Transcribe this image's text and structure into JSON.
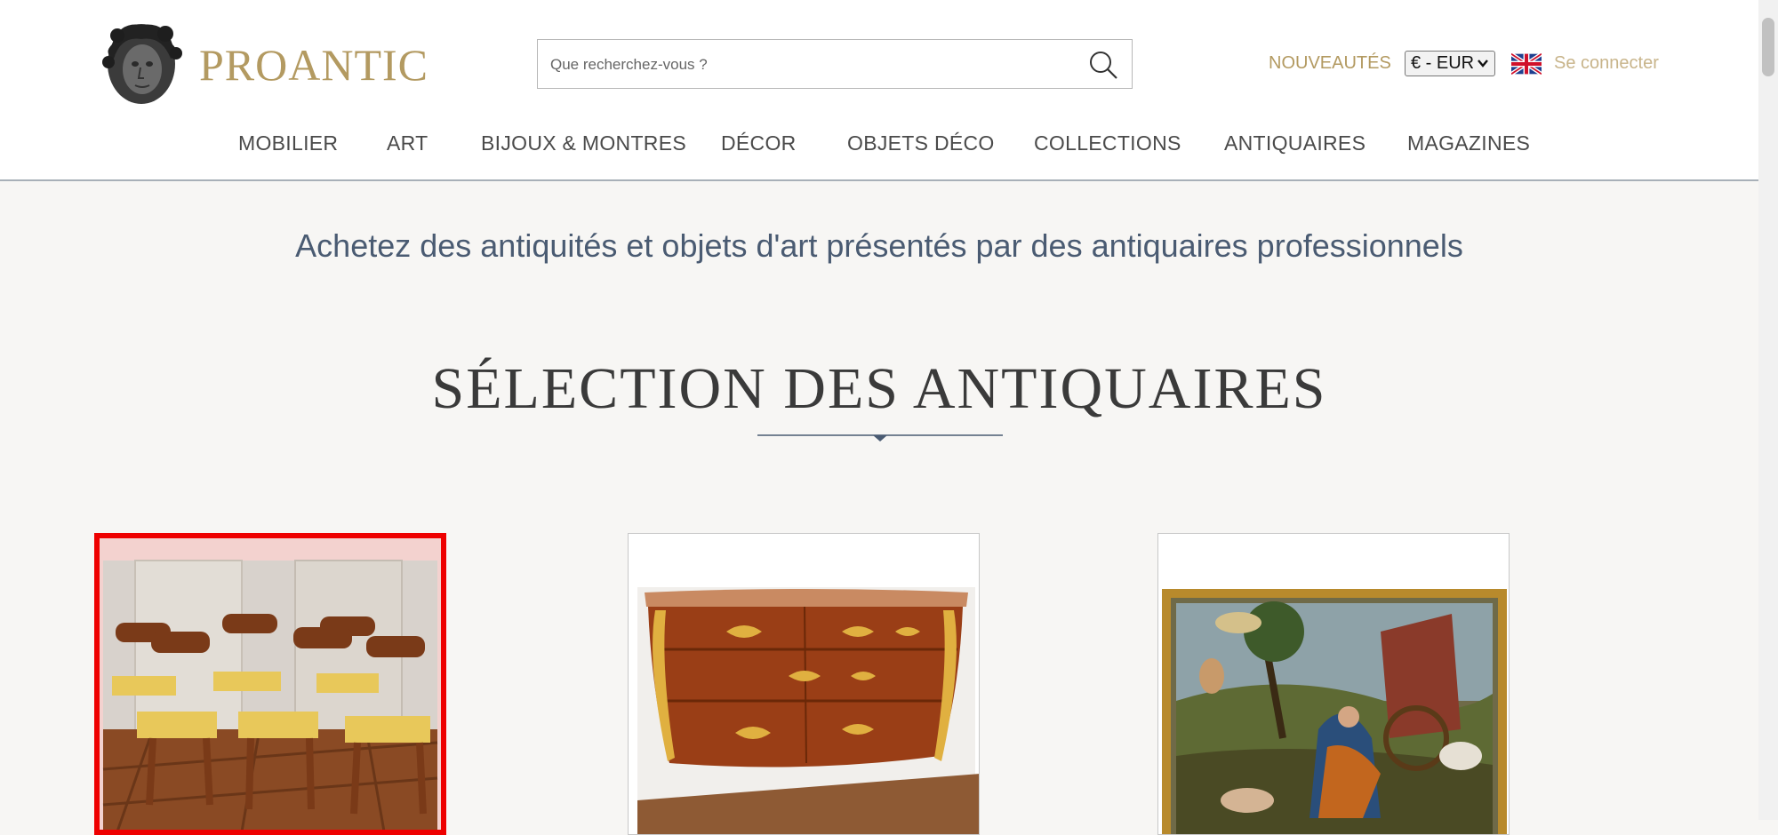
{
  "header": {
    "brand": "PROANTIC",
    "search_placeholder": "Que recherchez-vous ?",
    "nouveautes": "NOUVEAUTÉS",
    "currency": "€ - EUR",
    "login": "Se connecter"
  },
  "nav": {
    "items": [
      "MOBILIER",
      "ART",
      "BIJOUX & MONTRES",
      "DÉCOR",
      "OBJETS DÉCO",
      "COLLECTIONS",
      "ANTIQUAIRES",
      "MAGAZINES"
    ]
  },
  "main": {
    "tagline": "Achetez des antiquités et objets d'art présentés par des antiquaires professionnels",
    "section_title": "SÉLECTION DES ANTIQUAIRES"
  },
  "colors": {
    "brand_gold": "#b39a61",
    "tagline_blue": "#4a5b72",
    "selection_red": "#ee0000"
  }
}
